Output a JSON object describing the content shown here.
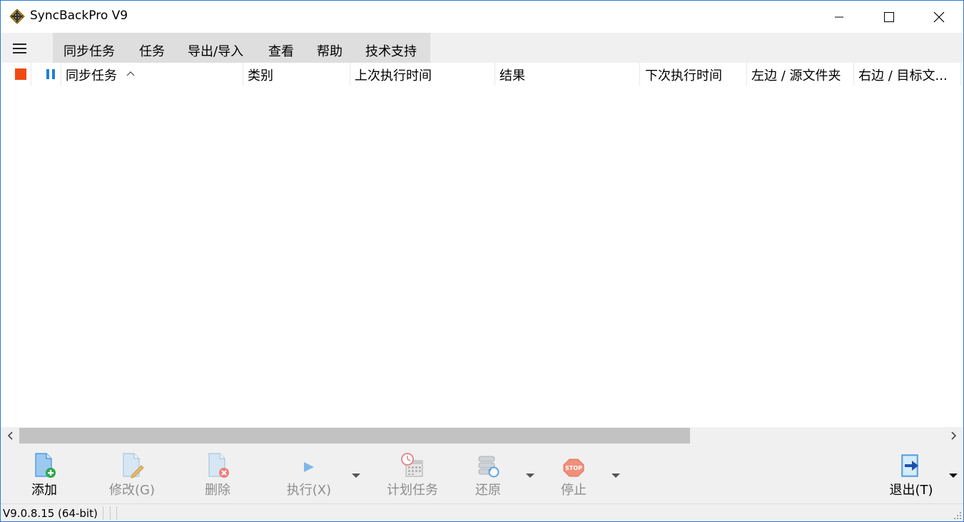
{
  "window": {
    "title": "SyncBackPro V9"
  },
  "menu": {
    "items": [
      "同步任务",
      "任务",
      "导出/导入",
      "查看",
      "帮助",
      "技术支持"
    ]
  },
  "columns": {
    "name": "同步任务",
    "type": "类别",
    "last_run": "上次执行时间",
    "result": "结果",
    "next_run": "下次执行时间",
    "left_source": "左边 / 源文件夹",
    "right_dest": "右边 / 目标文..."
  },
  "toolbar": {
    "add": "添加",
    "modify": "修改(G)",
    "delete": "删除",
    "run": "执行(X)",
    "schedule": "计划任务",
    "restore": "还原",
    "stop": "停止",
    "exit": "退出(T)"
  },
  "status": {
    "version": "V9.0.8.15 (64-bit)"
  },
  "colors": {
    "accent_border": "#2b79d8",
    "stop_square": "#f04a14",
    "pause_blue": "#1e7fd6",
    "scroll_thumb": "#c2c2c2"
  },
  "scrollbar": {
    "horizontal_thumb_fraction": 0.71
  }
}
